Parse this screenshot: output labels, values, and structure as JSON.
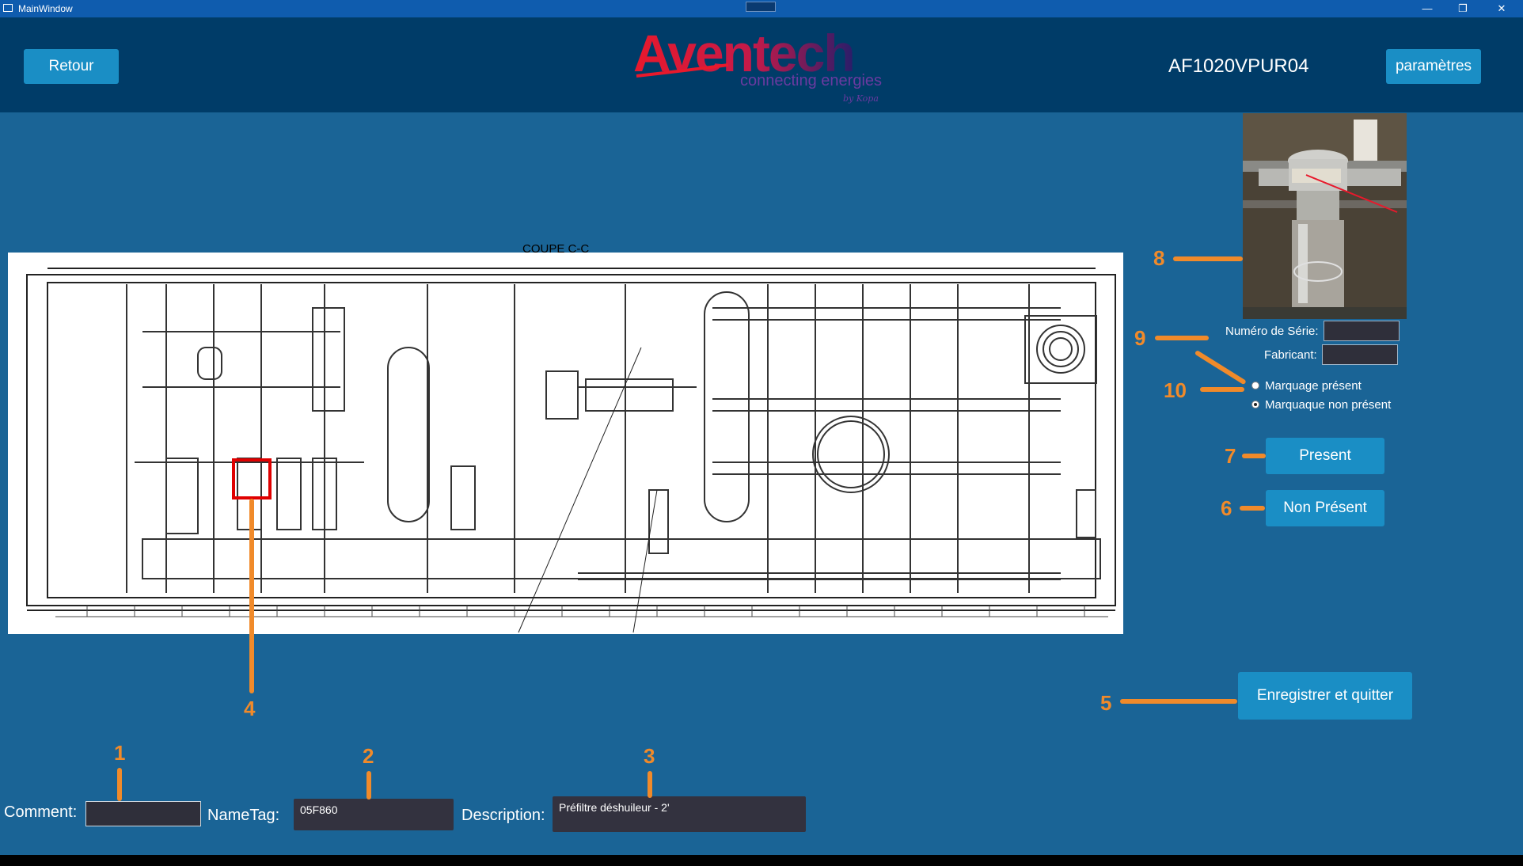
{
  "window": {
    "title": "MainWindow",
    "minimize": "—",
    "restore": "❐",
    "close": "✕"
  },
  "header": {
    "back_label": "Retour",
    "machine_id": "AF1020VPUR04",
    "settings_label": "paramètres",
    "logo": {
      "brand": "Aventech",
      "tagline": "connecting energies",
      "by": "by Kopa"
    }
  },
  "diagram": {
    "section_title": "COUPE C-C"
  },
  "form": {
    "serial_label": "Numéro de Série:",
    "serial_value": "",
    "manufacturer_label": "Fabricant:",
    "manufacturer_value": "",
    "radio_marking_present": "Marquage présent",
    "radio_marking_absent": "Marquaque non présent",
    "present_label": "Present",
    "absent_label": "Non Présent",
    "save_label": "Enregistrer et quitter"
  },
  "bottom": {
    "comment_label": "Comment:",
    "comment_value": "",
    "nametag_label": "NameTag:",
    "nametag_value": "05F860",
    "description_label": "Description:",
    "description_value": "Préfiltre déshuileur - 2'"
  },
  "annotations": [
    "1",
    "2",
    "3",
    "4",
    "5",
    "6",
    "7",
    "8",
    "9",
    "10"
  ],
  "colors": {
    "accent": "#1a8ec5",
    "background": "#1a6496",
    "header": "#003c68",
    "annotation": "#f08a2a",
    "highlight": "#e00000"
  }
}
